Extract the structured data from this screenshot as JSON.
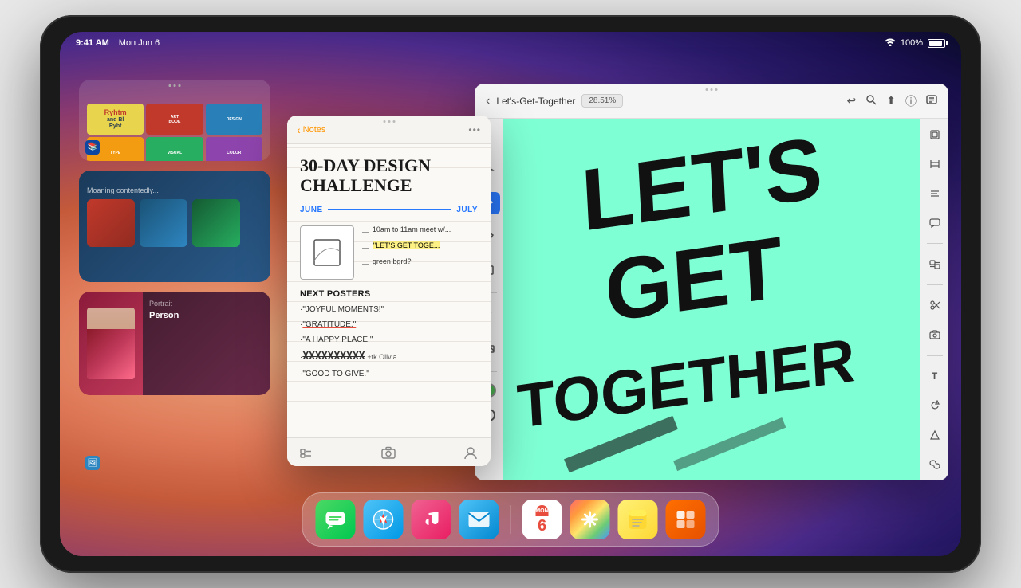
{
  "device": {
    "time": "9:41 AM",
    "date": "Mon Jun 6",
    "battery": "100%",
    "wifi": true
  },
  "status_bar": {
    "time": "9:41 AM",
    "date": "Mon Jun 6",
    "battery_percent": "100%"
  },
  "notes_app": {
    "back_label": "Notes",
    "title": "30-DAY DESIGN\nCHALLENGE",
    "timeline_start": "JUNE",
    "timeline_end": "JULY",
    "schedule_items": [
      "10am to 11am meet w/...",
      "\"LET'S GET TOGE...",
      "green bgrd?"
    ],
    "section_title": "NEXT POSTERS",
    "poster_items": [
      "\"JOYFUL MOMENTS!\"",
      "\"GRATITUDE.\"",
      "\"A HAPPY PLACE.\"",
      "XXXXXXXXXX +tk Olivia",
      "\"GOOD TO GIVE.\""
    ]
  },
  "design_app": {
    "title": "Let's-Get-Together",
    "zoom": "28.51%",
    "artwork_lines": [
      "LET'S",
      "GET",
      "TOGETHER"
    ],
    "background_color": "#7fffd4",
    "text_color": "#111111"
  },
  "dock": {
    "apps": [
      {
        "name": "Messages",
        "icon": "💬",
        "style": "messages"
      },
      {
        "name": "Safari",
        "icon": "🧭",
        "style": "safari"
      },
      {
        "name": "Music",
        "icon": "🎵",
        "style": "music"
      },
      {
        "name": "Mail",
        "icon": "✉️",
        "style": "mail"
      },
      {
        "name": "Calendar",
        "day": "MON",
        "number": "6",
        "style": "calendar"
      },
      {
        "name": "Photos",
        "icon": "🌅",
        "style": "photos"
      },
      {
        "name": "Notes",
        "icon": "📝",
        "style": "notes"
      },
      {
        "name": "Multi",
        "icon": "⊞",
        "style": "multiapp"
      }
    ]
  },
  "left_cards": {
    "reading_app_title": "Ryhtm and Bl...",
    "middle_card_title": "Moaning contentedly...",
    "bottom_card_title": "Person"
  },
  "icons": {
    "chevron_left": "‹",
    "chevron_right": "›",
    "layers": "◫",
    "pen": "✏",
    "select": "↖",
    "shape": "⬜",
    "text": "T",
    "image": "🖼",
    "gear": "⚙",
    "share": "⬆",
    "undo": "↩",
    "search": "🔍",
    "info": "ⓘ",
    "link": "🔗",
    "rotate": "↺",
    "scissor": "✂",
    "camera": "📷",
    "comment": "💬",
    "transfer": "⇄",
    "more": "•••"
  }
}
